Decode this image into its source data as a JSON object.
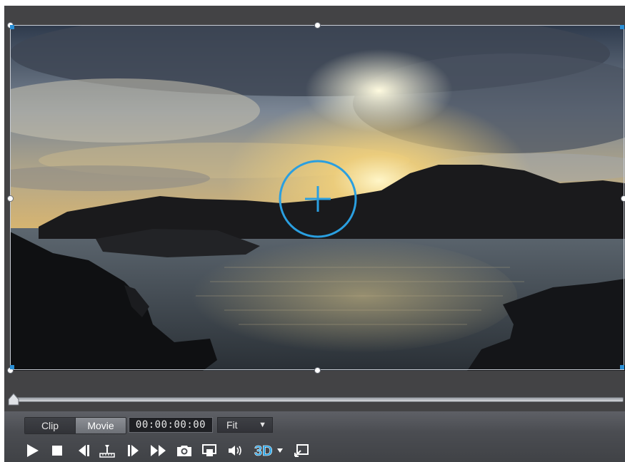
{
  "player": {
    "mode_tabs": [
      {
        "label": "Clip",
        "active": false
      },
      {
        "label": "Movie",
        "active": true
      }
    ],
    "timecode": "00:00:00:00",
    "zoom": {
      "selected": "Fit"
    },
    "scrubber_position": 0,
    "toolbar_icons": [
      "play-icon",
      "stop-icon",
      "previous-frame-icon",
      "split-icon",
      "next-frame-icon",
      "fast-forward-icon",
      "snapshot-icon",
      "display-mode-icon",
      "volume-icon",
      "3d-mode-icon",
      "3d-dropdown-icon",
      "enlarge-preview-icon"
    ],
    "toolbar_3d_label": "3D"
  },
  "colors": {
    "accent": "#2a9fe0",
    "panel_bg": "#434345",
    "controls_bg": "#4b4d52"
  }
}
